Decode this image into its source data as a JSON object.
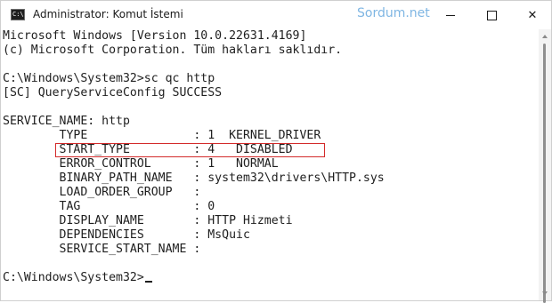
{
  "window": {
    "title": "Administrator: Komut İstemi",
    "watermark": "Sordum.net",
    "icon_text": "C:\\."
  },
  "controls": {
    "minimize": "minimize-icon",
    "maximize": "maximize-icon",
    "close": "✕"
  },
  "console": {
    "lines": [
      "Microsoft Windows [Version 10.0.22631.4169]",
      "(c) Microsoft Corporation. Tüm hakları saklıdır.",
      "",
      "C:\\Windows\\System32>sc qc http",
      "[SC] QueryServiceConfig SUCCESS",
      "",
      "SERVICE_NAME: http",
      "        TYPE               : 1  KERNEL_DRIVER",
      "        START_TYPE         : 4   DISABLED",
      "        ERROR_CONTROL      : 1   NORMAL",
      "        BINARY_PATH_NAME   : system32\\drivers\\HTTP.sys",
      "        LOAD_ORDER_GROUP   :",
      "        TAG                : 0",
      "        DISPLAY_NAME       : HTTP Hizmeti",
      "        DEPENDENCIES       : MsQuic",
      "        SERVICE_START_NAME :",
      "",
      "C:\\Windows\\System32>"
    ]
  },
  "colors": {
    "highlight_border": "#d32b2b",
    "watermark": "#7fb6e3",
    "text": "#1e1e1e"
  }
}
